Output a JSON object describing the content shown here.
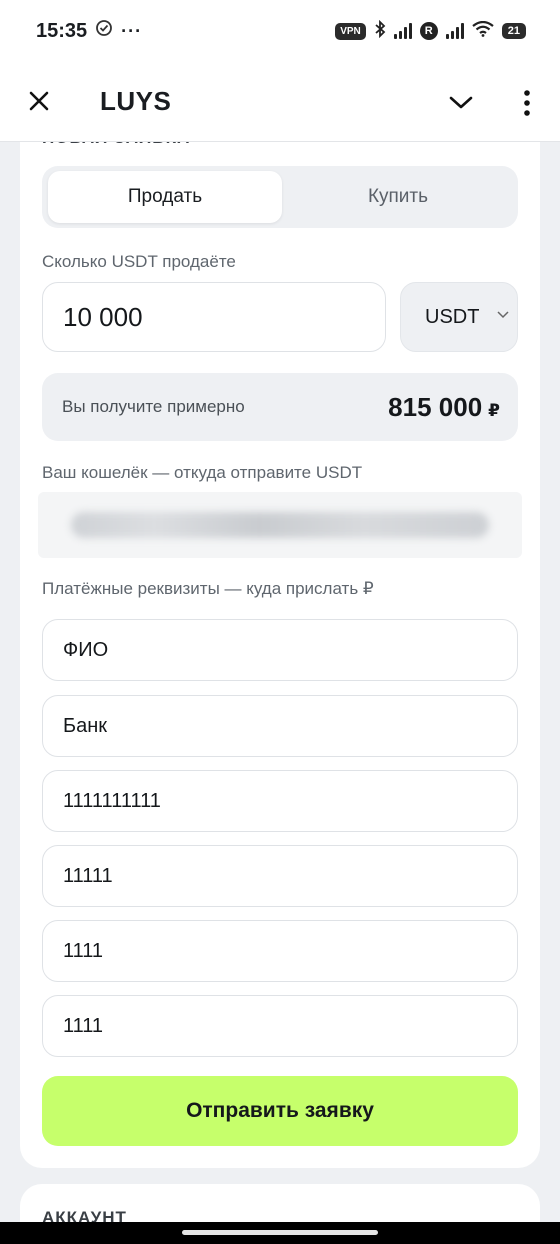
{
  "status_bar": {
    "time": "15:35",
    "more": "···",
    "vpn": "VPN",
    "carrier_badge": "R",
    "battery": "21"
  },
  "header": {
    "title": "LUYS"
  },
  "form": {
    "heading": "НОВАЯ ЗАЯВКА",
    "tabs": [
      {
        "label": "Продать",
        "active": true
      },
      {
        "label": "Купить",
        "active": false
      }
    ],
    "amount_label": "Сколько USDT продаёте",
    "amount_value": "10 000",
    "currency": "USDT",
    "receive_label": "Вы получите примерно",
    "receive_value": "815 000",
    "receive_currency": "₽",
    "wallet_label": "Ваш кошелёк — откуда отправите USDT",
    "payment_label": "Платёжные реквизиты — куда прислать ₽",
    "payment_fields": [
      {
        "value": "ФИО"
      },
      {
        "value": "Банк"
      },
      {
        "value": "1111111111"
      },
      {
        "value": "11111"
      },
      {
        "value": "1111"
      },
      {
        "value": "1111"
      }
    ],
    "submit_label": "Отправить заявку"
  },
  "account": {
    "heading": "АККАУНТ"
  },
  "colors": {
    "accent": "#c6ff6b",
    "background": "#eef0f3"
  }
}
